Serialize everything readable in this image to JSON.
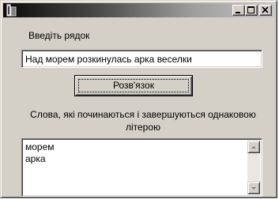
{
  "window": {
    "title": "",
    "icons": {
      "app": "app-icon",
      "minimize": "minimize-icon",
      "maximize": "maximize-icon",
      "close": "close-icon"
    }
  },
  "form": {
    "input_label": "Введіть рядок",
    "input_value": "Над морем розкинулась арка веселки",
    "solve_button": "Розв'язок",
    "result_label": "Слова, які починаються і завершуються однаковою літерою",
    "result_items": [
      "морем",
      "арка"
    ]
  },
  "colors": {
    "face": "#d4d0c8",
    "titlebar_start": "#0a0a0a",
    "titlebar_end": "#c4c4c4"
  }
}
